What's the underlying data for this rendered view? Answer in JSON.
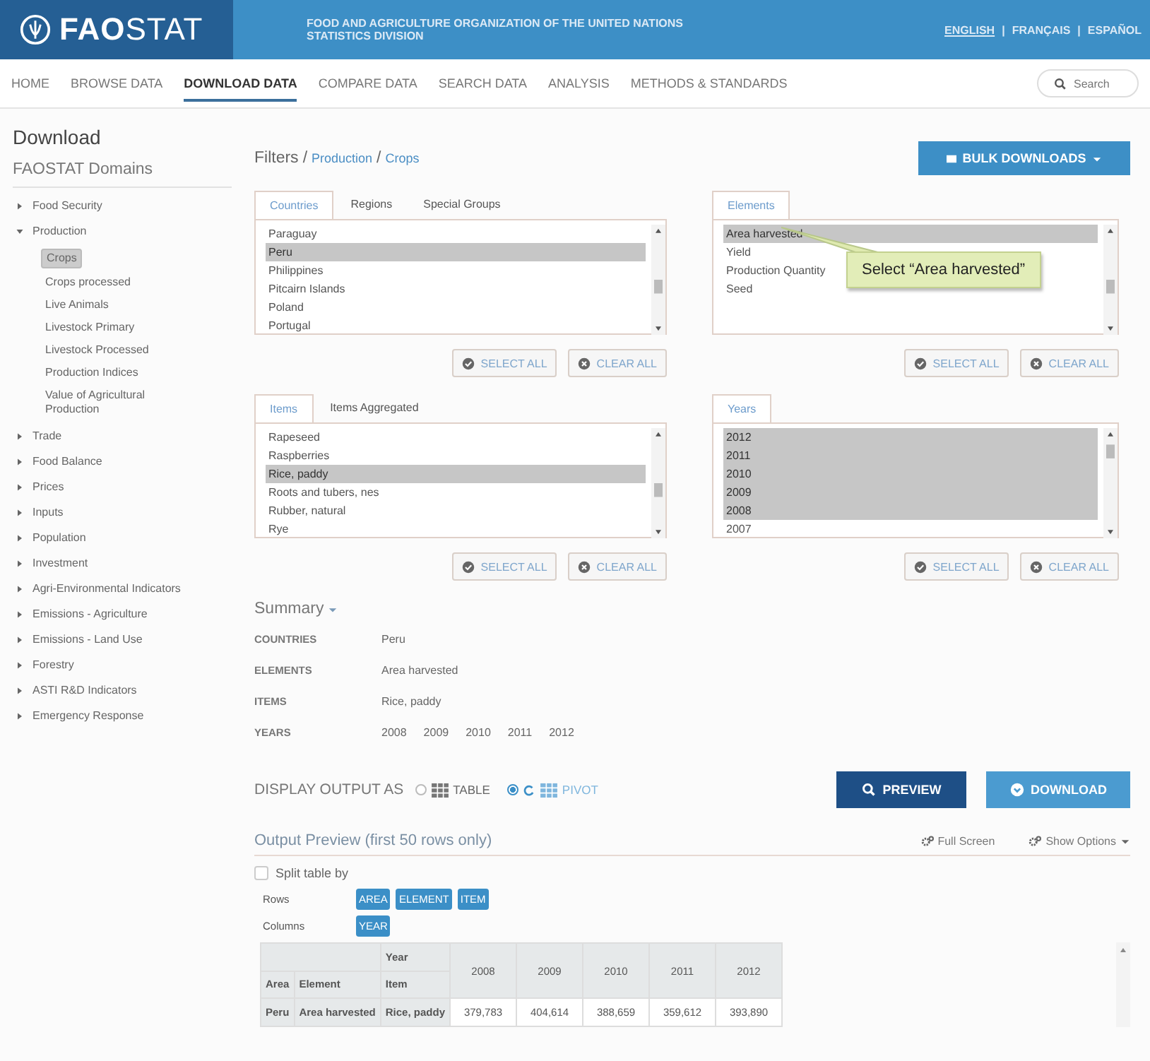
{
  "header": {
    "logo": "**FAO**STAT",
    "org_lines": [
      "FOOD AND AGRICULTURE ORGANIZATION OF THE UNITED NATIONS",
      "STATISTICS DIVISION"
    ],
    "languages": [
      {
        "label": "ENGLISH",
        "selected": true
      },
      {
        "label": "FRANÇAIS",
        "selected": false
      },
      {
        "label": "ESPAÑOL",
        "selected": false
      }
    ],
    "separators": [
      "|",
      "|"
    ]
  },
  "nav": {
    "items": [
      {
        "label": "HOME",
        "selected": false
      },
      {
        "label": "BROWSE DATA",
        "selected": false
      },
      {
        "label": "DOWNLOAD DATA",
        "selected": true
      },
      {
        "label": "COMPARE DATA",
        "selected": false
      },
      {
        "label": "SEARCH DATA",
        "selected": false
      },
      {
        "label": "ANALYSIS",
        "selected": false
      },
      {
        "label": "METHODS & STANDARDS",
        "selected": false
      }
    ],
    "search": {
      "placeholder": "Search"
    }
  },
  "page_title": "Download",
  "sidebar": {
    "title": "FAOSTAT Domains",
    "items": [
      {
        "label": "Food Security",
        "expanded": false
      },
      {
        "label": "Production",
        "expanded": true,
        "children": [
          {
            "label": "Crops",
            "selected": true
          },
          {
            "label": "Crops processed",
            "selected": false
          },
          {
            "label": "Live Animals",
            "selected": false
          },
          {
            "label": "Livestock Primary",
            "selected": false
          },
          {
            "label": "Livestock Processed",
            "selected": false
          },
          {
            "label": "Production Indices",
            "selected": false
          },
          {
            "label": "Value of Agricultural Production",
            "selected": false
          }
        ]
      },
      {
        "label": "Trade",
        "expanded": false
      },
      {
        "label": "Food Balance",
        "expanded": false
      },
      {
        "label": "Prices",
        "expanded": false
      },
      {
        "label": "Inputs",
        "expanded": false
      },
      {
        "label": "Population",
        "expanded": false
      },
      {
        "label": "Investment",
        "expanded": false
      },
      {
        "label": "Agri-Environmental Indicators",
        "expanded": false
      },
      {
        "label": "Emissions - Agriculture",
        "expanded": false
      },
      {
        "label": "Emissions - Land Use",
        "expanded": false
      },
      {
        "label": "Forestry",
        "expanded": false
      },
      {
        "label": "ASTI R&D Indicators",
        "expanded": false
      },
      {
        "label": "Emergency Response",
        "expanded": false
      }
    ]
  },
  "breadcrumb": [
    {
      "text": "Filters",
      "kind": "title"
    },
    {
      "text": "/",
      "kind": "sep"
    },
    {
      "text": "Production",
      "kind": "link"
    },
    {
      "text": "/",
      "kind": "sep"
    },
    {
      "text": "Crops",
      "kind": "link"
    }
  ],
  "bulk_button": "BULK DOWNLOADS",
  "panels": [
    {
      "tabs": [
        {
          "label": "Countries",
          "selected": true
        },
        {
          "label": "Regions",
          "selected": false
        },
        {
          "label": "Special Groups",
          "selected": false
        }
      ],
      "items": [
        {
          "label": "Paraguay",
          "selected": false
        },
        {
          "label": "Peru",
          "selected": true
        },
        {
          "label": "Philippines",
          "selected": false
        },
        {
          "label": "Pitcairn Islands",
          "selected": false
        },
        {
          "label": "Poland",
          "selected": false
        },
        {
          "label": "Portugal",
          "selected": false
        }
      ],
      "buttons": [
        "SELECT ALL",
        "CLEAR ALL"
      ]
    },
    {
      "tabs": [
        {
          "label": "Elements",
          "selected": true
        }
      ],
      "items": [
        {
          "label": "Area harvested",
          "selected": true
        },
        {
          "label": "Yield",
          "selected": false
        },
        {
          "label": "Production Quantity",
          "selected": false
        },
        {
          "label": "Seed",
          "selected": false
        }
      ],
      "tooltip": "Select “Area harvested”",
      "buttons": [
        "SELECT ALL",
        "CLEAR ALL"
      ]
    },
    {
      "tabs": [
        {
          "label": "Items",
          "selected": true
        },
        {
          "label": "Items Aggregated",
          "selected": false
        }
      ],
      "items": [
        {
          "label": "Rapeseed",
          "selected": false
        },
        {
          "label": "Raspberries",
          "selected": false
        },
        {
          "label": "Rice, paddy",
          "selected": true
        },
        {
          "label": "Roots and tubers, nes",
          "selected": false
        },
        {
          "label": "Rubber, natural",
          "selected": false
        },
        {
          "label": "Rye",
          "selected": false
        }
      ],
      "buttons": [
        "SELECT ALL",
        "CLEAR ALL"
      ]
    },
    {
      "tabs": [
        {
          "label": "Years",
          "selected": true
        }
      ],
      "items": [
        {
          "label": "2012",
          "selected": true
        },
        {
          "label": "2011",
          "selected": true
        },
        {
          "label": "2010",
          "selected": true
        },
        {
          "label": "2009",
          "selected": true
        },
        {
          "label": "2008",
          "selected": true
        },
        {
          "label": "2007",
          "selected": false
        }
      ],
      "buttons": [
        "SELECT ALL",
        "CLEAR ALL"
      ]
    }
  ],
  "summary": {
    "title": "Summary",
    "rows": [
      {
        "label": "COUNTRIES",
        "values": [
          "Peru"
        ]
      },
      {
        "label": "ELEMENTS",
        "values": [
          "Area harvested"
        ]
      },
      {
        "label": "ITEMS",
        "values": [
          "Rice, paddy"
        ]
      },
      {
        "label": "YEARS",
        "values": [
          "2008",
          "2009",
          "2010",
          "2011",
          "2012"
        ]
      }
    ]
  },
  "display": {
    "label": "DISPLAY OUTPUT AS",
    "options": [
      {
        "label": "TABLE",
        "selected": false
      },
      {
        "label": "PIVOT",
        "selected": true
      }
    ],
    "preview": "PREVIEW",
    "download": "DOWNLOAD"
  },
  "output": {
    "title": "Output Preview (first 50 rows only)",
    "actions": [
      "Full Screen",
      "Show Options"
    ],
    "split": {
      "label": "Split table by",
      "checked": false
    },
    "rows_label": "Rows",
    "rows_tags": [
      "AREA",
      "ELEMENT",
      "ITEM"
    ],
    "columns_label": "Columns",
    "columns_tags": [
      "YEAR"
    ],
    "table": {
      "year_label": "Year",
      "row_headers": [
        "Area",
        "Element",
        "Item"
      ],
      "years": [
        "2008",
        "2009",
        "2010",
        "2011",
        "2012"
      ],
      "rows": [
        {
          "keys": [
            "Peru",
            "Area harvested",
            "Rice, paddy"
          ],
          "values": [
            "379,783",
            "404,614",
            "388,659",
            "359,612",
            "393,890"
          ]
        }
      ]
    }
  }
}
